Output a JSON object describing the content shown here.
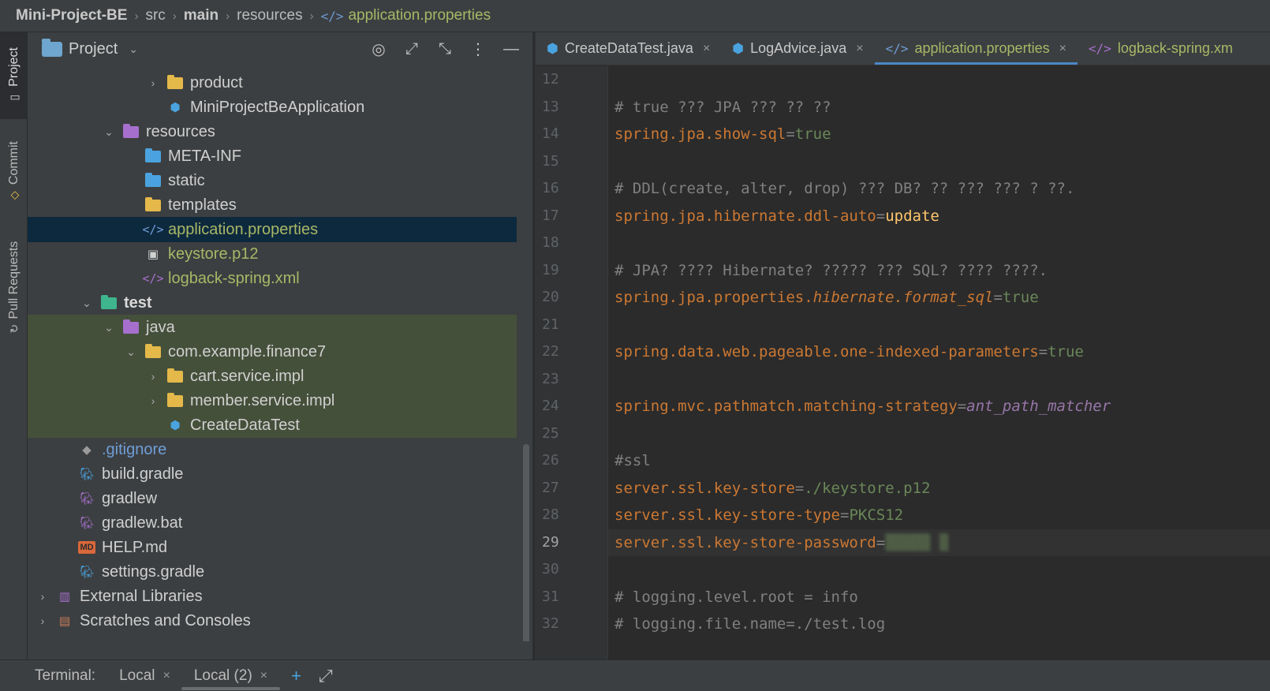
{
  "breadcrumb": {
    "items": [
      "Mini-Project-BE",
      "src",
      "main",
      "resources"
    ],
    "current": "application.properties",
    "current_icon": "</>"
  },
  "tool_stripe": {
    "project": "Project",
    "commit": "Commit",
    "pull_requests": "Pull Requests"
  },
  "project_panel": {
    "title": "Project",
    "tree": [
      {
        "label": "product",
        "icon": "folder"
      },
      {
        "label": "MiniProjectBeApplication",
        "icon": "spring-class"
      },
      {
        "label": "resources",
        "icon": "resources-folder"
      },
      {
        "label": "META-INF",
        "icon": "folder"
      },
      {
        "label": "static",
        "icon": "web-folder"
      },
      {
        "label": "templates",
        "icon": "folder"
      },
      {
        "label": "application.properties",
        "icon": "</>"
      },
      {
        "label": "keystore.p12",
        "icon": "file"
      },
      {
        "label": "logback-spring.xml",
        "icon": "</>"
      },
      {
        "label": "test",
        "icon": "test-folder"
      },
      {
        "label": "java",
        "icon": "test-source-folder"
      },
      {
        "label": "com.example.finance7",
        "icon": "package"
      },
      {
        "label": "cart.service.impl",
        "icon": "package"
      },
      {
        "label": "member.service.impl",
        "icon": "package"
      },
      {
        "label": "CreateDataTest",
        "icon": "class"
      },
      {
        "label": ".gitignore",
        "icon": "git"
      },
      {
        "label": "build.gradle",
        "icon": "gradle"
      },
      {
        "label": "gradlew",
        "icon": "gradle"
      },
      {
        "label": "gradlew.bat",
        "icon": "gradle"
      },
      {
        "label": "HELP.md",
        "icon": "MD"
      },
      {
        "label": "settings.gradle",
        "icon": "gradle"
      },
      {
        "label": "External Libraries",
        "icon": "library"
      },
      {
        "label": "Scratches and Consoles",
        "icon": "scratches"
      }
    ]
  },
  "editor": {
    "tabs": [
      {
        "label": "CreateDataTest.java",
        "icon": "java-class"
      },
      {
        "label": "LogAdvice.java",
        "icon": "java-class"
      },
      {
        "label": "application.properties",
        "icon": "</>"
      },
      {
        "label": "logback-spring.xm",
        "icon": "</>"
      }
    ],
    "line_numbers": [
      "12",
      "13",
      "14",
      "15",
      "16",
      "17",
      "18",
      "19",
      "20",
      "21",
      "22",
      "23",
      "24",
      "25",
      "26",
      "27",
      "28",
      "29",
      "30",
      "31",
      "32"
    ],
    "current_line": "29",
    "code": {
      "l13": "# true ??? JPA ??? ?? ??",
      "l14_key": "spring.jpa.show-sql",
      "l14_val": "true",
      "l16": "# DDL(create, alter, drop) ??? DB? ?? ??? ??? ? ??.",
      "l17_key": "spring.jpa.hibernate.ddl-auto",
      "l17_val": "update",
      "l19": "# JPA? ???? Hibernate? ????? ??? SQL? ???? ????.",
      "l20_key_a": "spring.jpa.properties.",
      "l20_key_b": "hibernate.format_sql",
      "l20_val": "true",
      "l22_key": "spring.data.web.pageable.one-indexed-parameters",
      "l22_val": "true",
      "l24_key": "spring.mvc.pathmatch.matching-strategy",
      "l24_val": "ant_path_matcher",
      "l26": "#ssl",
      "l27_key": "server.ssl.key-store",
      "l27_val": "./keystore.p12",
      "l28_key": "server.ssl.key-store-type",
      "l28_val": "PKCS12",
      "l29_key": "server.ssl.key-store-password",
      "l29_val": "▒▒▒▒▒ ▒",
      "l31": "# logging.level.root = info",
      "l32": "# logging.file.name=./test.log",
      "eq": "="
    }
  },
  "terminal": {
    "label": "Terminal:",
    "tabs": [
      "Local",
      "Local (2)"
    ]
  },
  "colors": {
    "accent": "#4a88c7",
    "selection": "#0d293e",
    "test_highlight": "#45503b",
    "keyword": "#cc7832",
    "string": "#6a8759"
  }
}
